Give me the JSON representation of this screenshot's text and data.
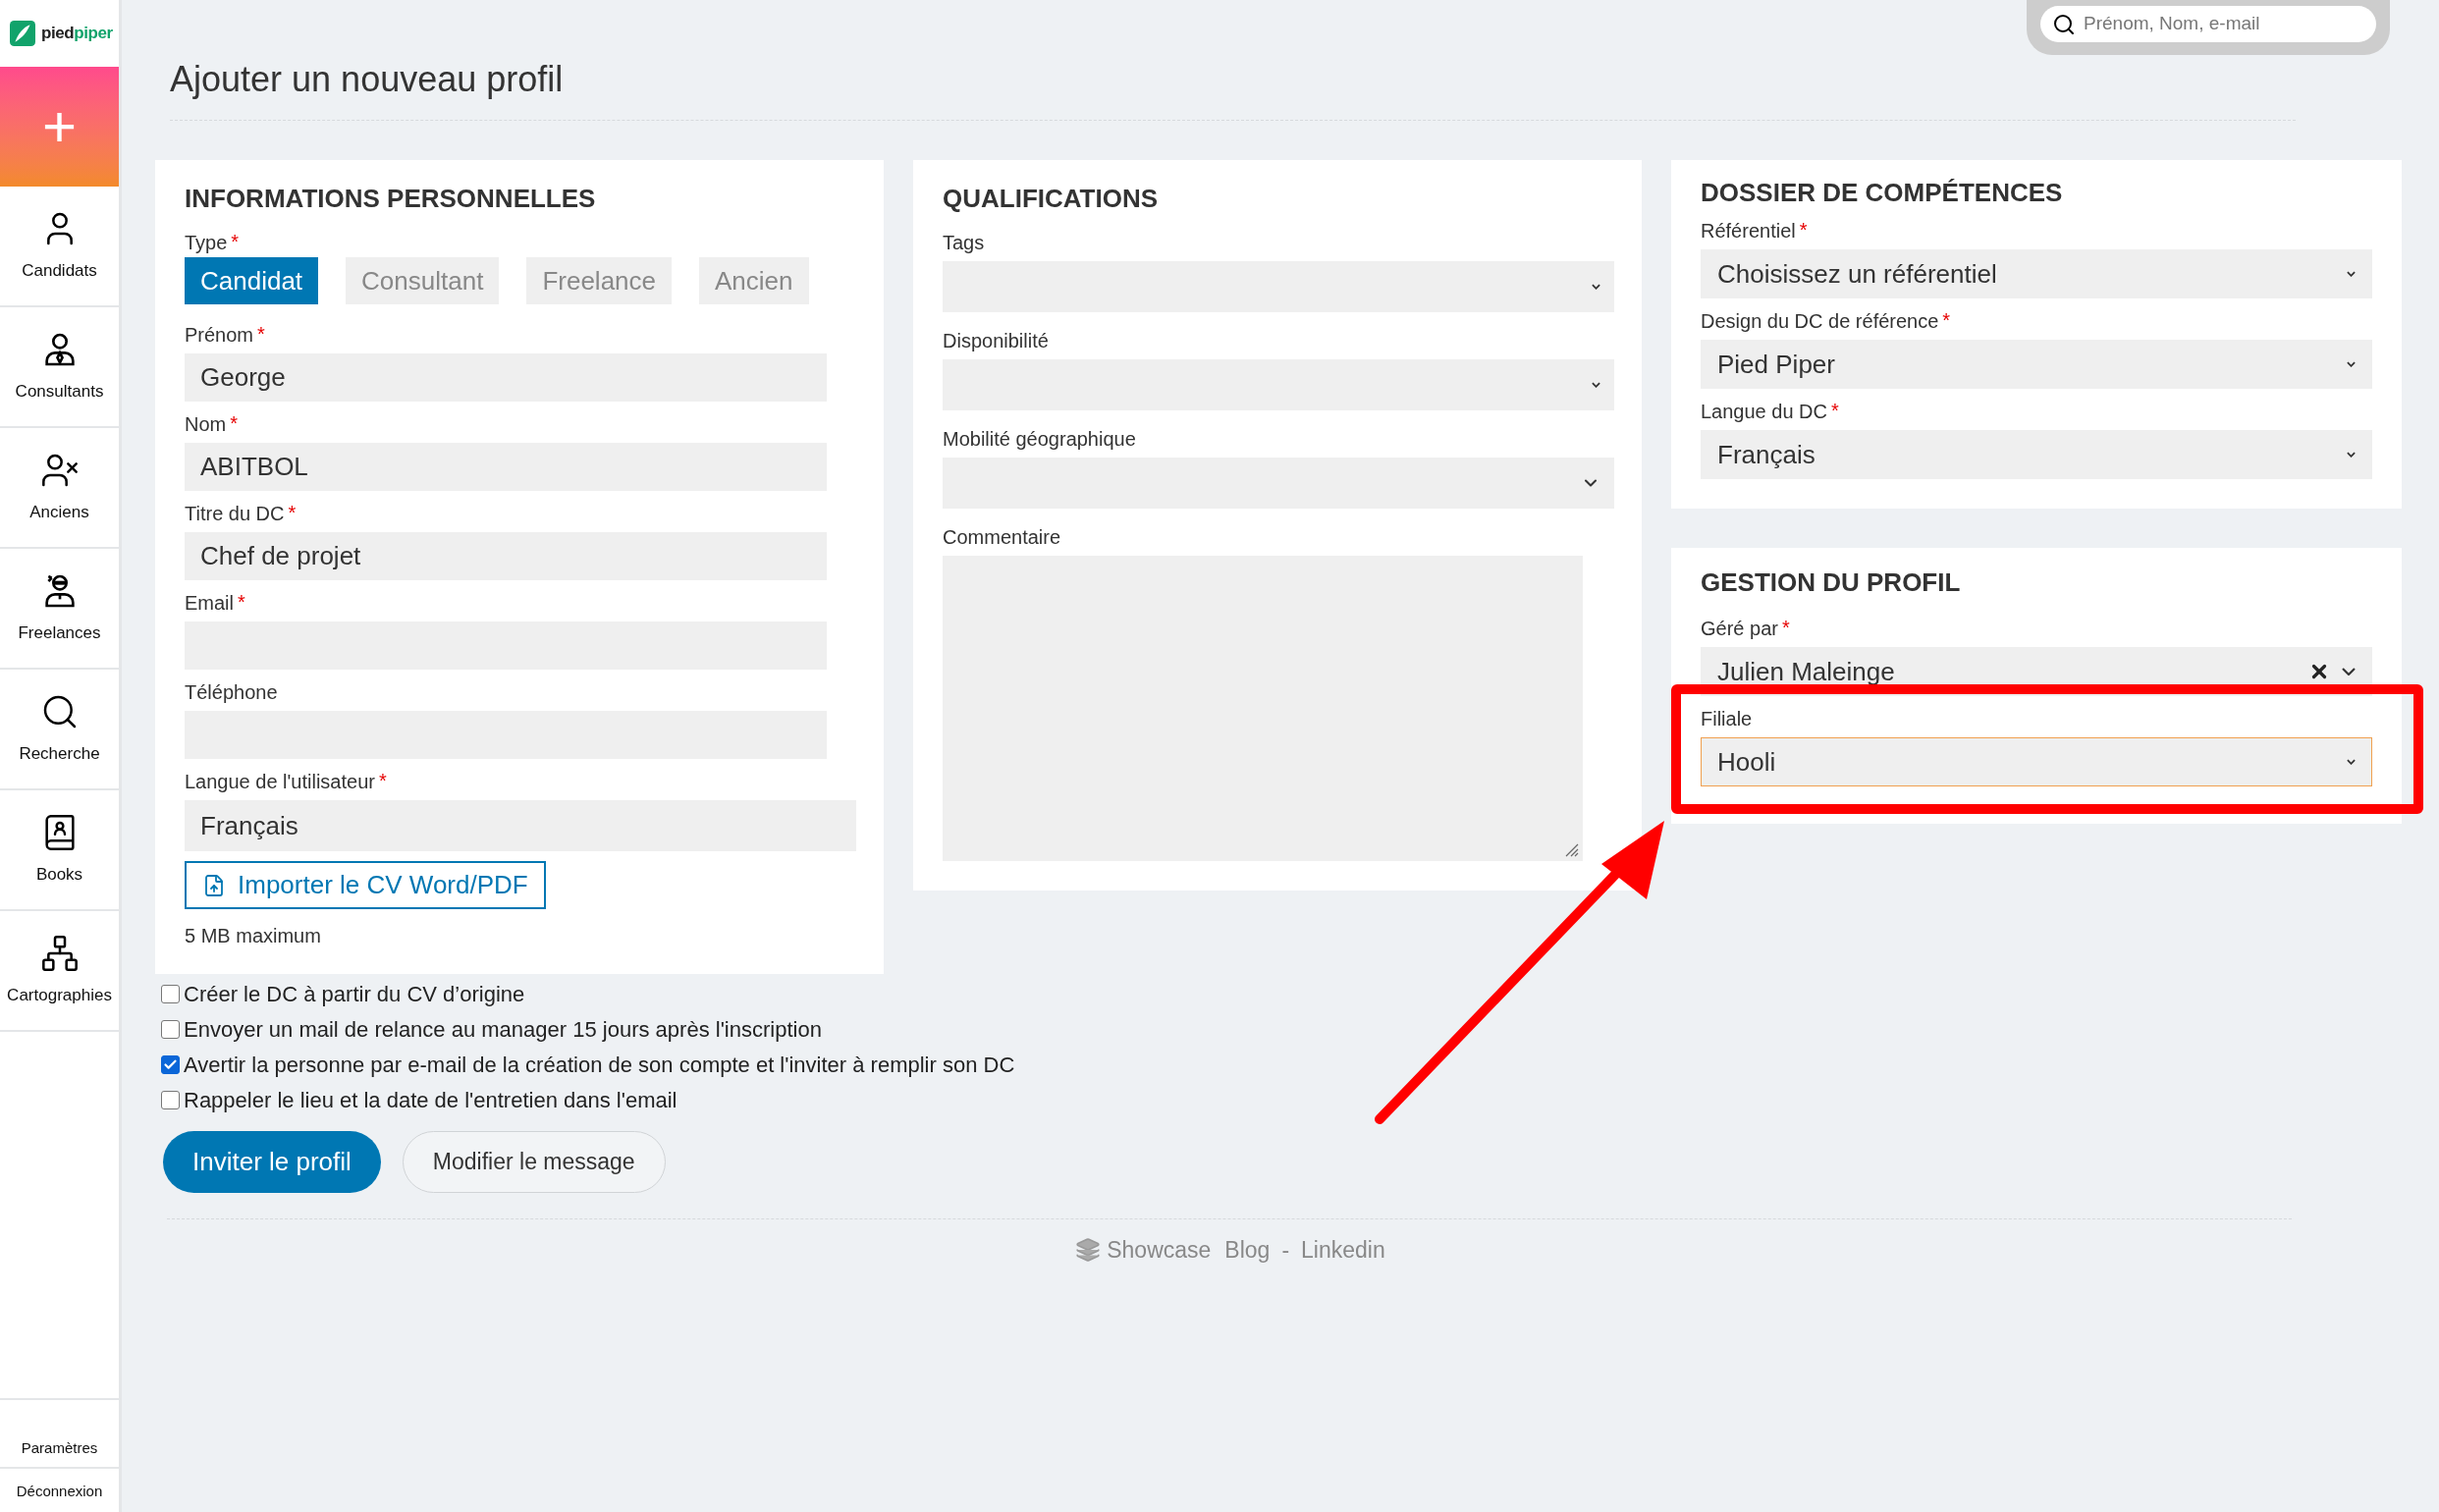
{
  "sidebar": {
    "logo": {
      "part_1": "pied",
      "part_2": "piper"
    },
    "add_button": "+",
    "items": [
      {
        "kind": "person",
        "label": "Candidats"
      },
      {
        "kind": "tie",
        "label": "Consultants"
      },
      {
        "kind": "person-off",
        "label": "Anciens"
      },
      {
        "kind": "masked",
        "label": "Freelances"
      },
      {
        "kind": "search",
        "label": "Recherche"
      },
      {
        "kind": "book",
        "label": "Books"
      },
      {
        "kind": "tree",
        "label": "Cartographies"
      }
    ],
    "bottom_items": [
      "Paramètres",
      "Déconnexion"
    ]
  },
  "search": {
    "placeholder": "Prénom, Nom, e-mail"
  },
  "page_title": "Ajouter un nouveau profil",
  "personal": {
    "title": "INFORMATIONS PERSONNELLES",
    "type_label": "Type",
    "type_required_mark": "*",
    "types": [
      {
        "label": "Candidat",
        "selected": true
      },
      {
        "label": "Consultant",
        "selected": false
      },
      {
        "label": "Freelance",
        "selected": false
      },
      {
        "label": "Ancien",
        "selected": false
      }
    ],
    "fields": [
      {
        "label": "Prénom",
        "required_mark": "*",
        "value": "George",
        "wide": false
      },
      {
        "label": "Nom",
        "required_mark": "*",
        "value": "ABITBOL",
        "wide": false
      },
      {
        "label": "Titre du DC",
        "required_mark": "*",
        "value": "Chef de projet",
        "wide": false
      },
      {
        "label": "Email",
        "required_mark": "*",
        "wide": false
      },
      {
        "label": "Téléphone",
        "wide": false
      },
      {
        "label": "Langue de l'utilisateur",
        "required_mark": "*",
        "value": "Français",
        "wide": true
      }
    ],
    "import_button": "Importer le CV Word/PDF",
    "import_note": "5 MB maximum"
  },
  "qualifications": {
    "title": "QUALIFICATIONS",
    "fields": [
      {
        "kind": "select",
        "label": "Tags"
      },
      {
        "kind": "select",
        "label": "Disponibilité"
      },
      {
        "kind": "select-large",
        "label": "Mobilité géographique"
      },
      {
        "kind": "textarea",
        "label": "Commentaire"
      }
    ]
  },
  "dossier": {
    "title": "DOSSIER DE COMPÉTENCES",
    "fields": [
      {
        "label": "Référentiel",
        "required_mark": "*",
        "value": "Choisissez un référentiel",
        "clearable": false,
        "focused": false
      },
      {
        "label": "Design du DC de référence",
        "required_mark": "*",
        "value": "Pied Piper",
        "clearable": false,
        "focused": false
      },
      {
        "label": "Langue du DC",
        "required_mark": "*",
        "value": "Français",
        "clearable": false,
        "focused": false
      }
    ]
  },
  "gestion": {
    "title": "GESTION DU PROFIL",
    "fields": [
      {
        "label": "Géré par",
        "required_mark": "*",
        "value": "Julien Maleinge",
        "clearable": true,
        "focused": false
      },
      {
        "label": "Filiale",
        "value": "Hooli",
        "clearable": false,
        "focused": true
      }
    ]
  },
  "options": [
    {
      "label": "Créer le DC à partir du CV d’origine",
      "checked": false
    },
    {
      "label": "Envoyer un mail de relance au manager 15 jours après l'inscription",
      "checked": false
    },
    {
      "label": "Avertir la personne par e-mail de la création de son compte et l'inviter à remplir son DC",
      "checked": true
    },
    {
      "label": "Rappeler le lieu et la date de l'entretien dans l'email",
      "checked": false
    }
  ],
  "actions": {
    "primary": "Inviter le profil",
    "secondary": "Modifier le message"
  },
  "footer": {
    "brand": "Showcase",
    "links": [
      "Blog",
      "Linkedin"
    ],
    "separator": "-"
  }
}
